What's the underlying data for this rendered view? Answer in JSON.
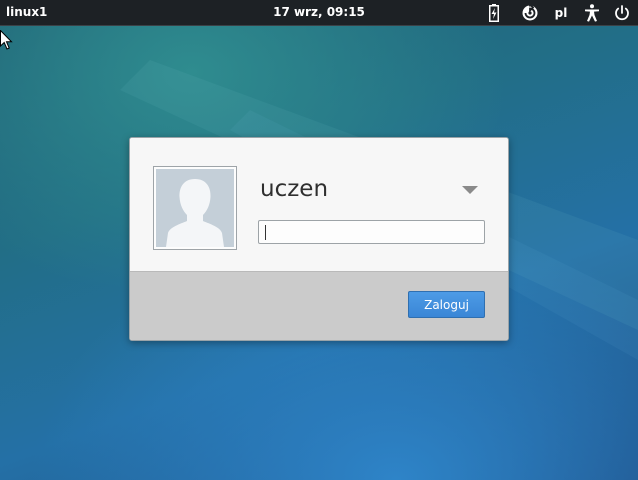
{
  "topbar": {
    "hostname": "linux1",
    "datetime": "17 wrz, 09:15",
    "battery_icon": "battery-icon",
    "session_icon": "session-menu-icon",
    "language": "pl",
    "accessibility_icon": "accessibility-icon",
    "power_icon": "power-icon"
  },
  "login": {
    "avatar_icon": "user-avatar-icon",
    "username": "uczen",
    "user_menu_icon": "chevron-down-icon",
    "password_value": "",
    "button_label": "Zaloguj"
  },
  "colors": {
    "topbar_bg": "#1d2125",
    "button_accent": "#3a86d6",
    "dialog_bottom": "#cbcbcb"
  }
}
